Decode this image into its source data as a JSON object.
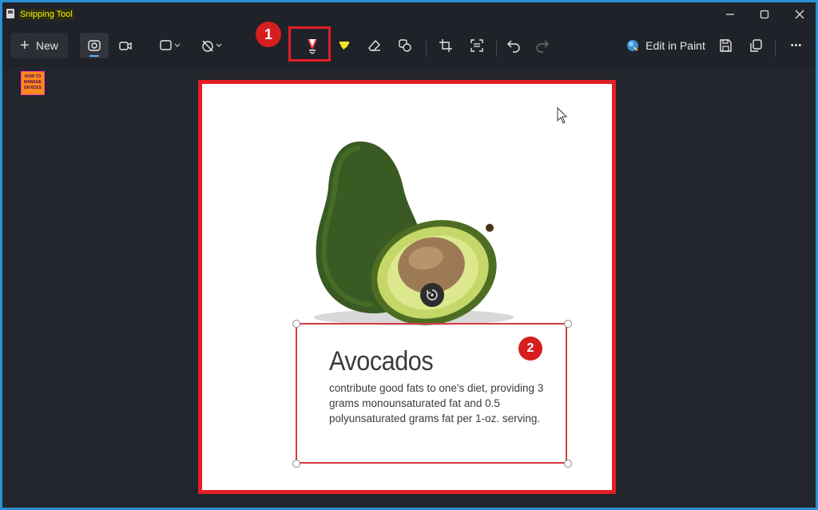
{
  "window": {
    "title": "Snipping Tool",
    "controls": {
      "minimize": "—",
      "maximize": "□",
      "close": "✕"
    }
  },
  "toolbar": {
    "new_label": "New",
    "edit_in_paint_label": "Edit in Paint",
    "more_label": "•••",
    "tools": [
      "camera-icon",
      "video-icon",
      "rectangle-mode-icon",
      "timer-icon",
      "ballpoint-pen-icon",
      "highlighter-icon",
      "eraser-icon",
      "shapes-icon",
      "crop-icon",
      "text-actions-icon",
      "undo-icon",
      "redo-icon",
      "paint-icon",
      "save-icon",
      "copy-icon"
    ]
  },
  "annotations": {
    "callout_1": "1",
    "callout_2": "2"
  },
  "snip": {
    "title": "Avocados",
    "body": "contribute good fats to one's diet, providing 3 grams monounsaturated fat and 0.5 polyunsaturated grams fat per 1-oz. serving."
  },
  "colors": {
    "annotation_red": "#e31e26",
    "highlighter_yellow": "#f5e52a",
    "pen_red": "#e8333b",
    "background": "#202229"
  }
}
